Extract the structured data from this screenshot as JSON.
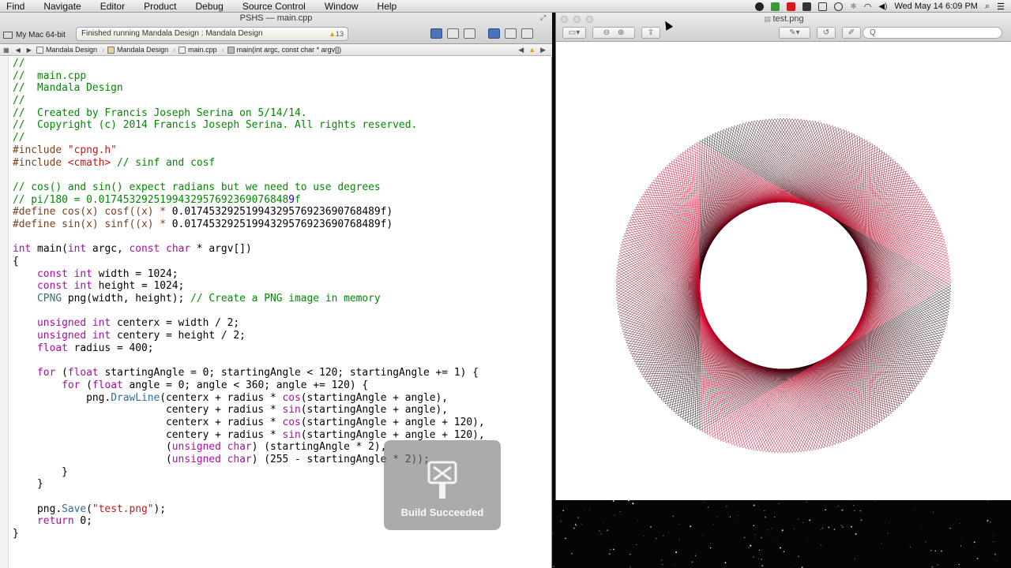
{
  "menubar": {
    "items": [
      "Find",
      "Navigate",
      "Editor",
      "Product",
      "Debug",
      "Source Control",
      "Window",
      "Help"
    ],
    "clock": "Wed May 14  6:09 PM"
  },
  "xcode": {
    "window_title": "PSHS — ",
    "file_title": "main.cpp",
    "scheme": "My Mac 64-bit",
    "activity": "Finished running Mandala Design : Mandala Design",
    "warning_count": "13",
    "breadcrumbs": [
      "Mandala Design",
      "Mandala Design",
      "main.cpp",
      "main(int argc, const char * argv[])"
    ],
    "hud_label": "Build Succeeded"
  },
  "code_lines": [
    [
      [
        "c-com",
        "//"
      ]
    ],
    [
      [
        "c-com",
        "//  main.cpp"
      ]
    ],
    [
      [
        "c-com",
        "//  Mandala Design"
      ]
    ],
    [
      [
        "c-com",
        "//"
      ]
    ],
    [
      [
        "c-com",
        "//  Created by Francis Joseph Serina on 5/14/14."
      ]
    ],
    [
      [
        "c-com",
        "//  Copyright (c) 2014 Francis Joseph Serina. All rights reserved."
      ]
    ],
    [
      [
        "c-com",
        "//"
      ]
    ],
    [
      [
        "c-pp",
        "#include "
      ],
      [
        "c-str",
        "\"cpng.h\""
      ]
    ],
    [
      [
        "c-pp",
        "#include "
      ],
      [
        "c-str",
        "<cmath>"
      ],
      [
        "c-com",
        " // sinf and cosf"
      ]
    ],
    [
      [
        "",
        ""
      ]
    ],
    [
      [
        "c-com",
        "// cos() and sin() expect radians but we need to use degrees"
      ]
    ],
    [
      [
        "c-com",
        "// pi/180 = 0.0174532925199432957692369076848"
      ],
      [
        "c-num",
        "9"
      ],
      [
        "c-com",
        "f"
      ]
    ],
    [
      [
        "c-pp",
        "#define cos(x) cosf((x) * "
      ],
      [
        "",
        "0.01745329251994329576923690768489f)"
      ]
    ],
    [
      [
        "c-pp",
        "#define sin(x) sinf((x) * "
      ],
      [
        "",
        "0.01745329251994329576923690768489f)"
      ]
    ],
    [
      [
        "",
        ""
      ]
    ],
    [
      [
        "c-kw",
        "int"
      ],
      [
        "",
        " main("
      ],
      [
        "c-kw",
        "int"
      ],
      [
        "",
        " argc, "
      ],
      [
        "c-kw",
        "const"
      ],
      [
        "",
        " "
      ],
      [
        "c-kw",
        "char"
      ],
      [
        "",
        " * argv[])"
      ]
    ],
    [
      [
        "",
        "{"
      ]
    ],
    [
      [
        "",
        "    "
      ],
      [
        "c-kw",
        "const int"
      ],
      [
        "",
        " width = 1024;"
      ]
    ],
    [
      [
        "",
        "    "
      ],
      [
        "c-kw",
        "const int"
      ],
      [
        "",
        " height = 1024;"
      ]
    ],
    [
      [
        "",
        "    "
      ],
      [
        "c-cls",
        "CPNG"
      ],
      [
        "",
        " png(width, height); "
      ],
      [
        "c-com",
        "// Create a PNG image in memory"
      ]
    ],
    [
      [
        "",
        ""
      ]
    ],
    [
      [
        "",
        "    "
      ],
      [
        "c-kw",
        "unsigned int"
      ],
      [
        "",
        " centerx = width / 2;"
      ]
    ],
    [
      [
        "",
        "    "
      ],
      [
        "c-kw",
        "unsigned int"
      ],
      [
        "",
        " centery = height / 2;"
      ]
    ],
    [
      [
        "",
        "    "
      ],
      [
        "c-kw",
        "float"
      ],
      [
        "",
        " radius = 400;"
      ]
    ],
    [
      [
        "",
        ""
      ]
    ],
    [
      [
        "",
        "    "
      ],
      [
        "c-kw",
        "for"
      ],
      [
        "",
        " ("
      ],
      [
        "c-kw",
        "float"
      ],
      [
        "",
        " startingAngle = 0; startingAngle < 120; startingAngle += 1) {"
      ]
    ],
    [
      [
        "",
        "        "
      ],
      [
        "c-kw",
        "for"
      ],
      [
        "",
        " ("
      ],
      [
        "c-kw",
        "float"
      ],
      [
        "",
        " angle = 0; angle < 360; angle += 120) {"
      ]
    ],
    [
      [
        "",
        "            png."
      ],
      [
        "c-fn",
        "DrawLine"
      ],
      [
        "",
        "(centerx + radius * "
      ],
      [
        "c-kw",
        "cos"
      ],
      [
        "",
        "(startingAngle + angle),"
      ]
    ],
    [
      [
        "",
        "                         centery + radius * "
      ],
      [
        "c-kw",
        "sin"
      ],
      [
        "",
        "(startingAngle + angle),"
      ]
    ],
    [
      [
        "",
        "                         centerx + radius * "
      ],
      [
        "c-kw",
        "cos"
      ],
      [
        "",
        "(startingAngle + angle + 120),"
      ]
    ],
    [
      [
        "",
        "                         centery + radius * "
      ],
      [
        "c-kw",
        "sin"
      ],
      [
        "",
        "(startingAngle + angle + 120),"
      ]
    ],
    [
      [
        "",
        "                         ("
      ],
      [
        "c-kw",
        "unsigned char"
      ],
      [
        "",
        ") (startingAngle * 2),"
      ]
    ],
    [
      [
        "",
        "                         ("
      ],
      [
        "c-kw",
        "unsigned char"
      ],
      [
        "",
        ") (255 - startingAngle * 2));"
      ]
    ],
    [
      [
        "",
        "        }"
      ]
    ],
    [
      [
        "",
        "    }"
      ]
    ],
    [
      [
        "",
        ""
      ]
    ],
    [
      [
        "",
        "    png."
      ],
      [
        "c-fn",
        "Save"
      ],
      [
        "",
        "("
      ],
      [
        "c-str",
        "\"test.png\""
      ],
      [
        "",
        ");"
      ]
    ],
    [
      [
        "",
        "    "
      ],
      [
        "c-kw",
        "return"
      ],
      [
        "",
        " 0;"
      ]
    ],
    [
      [
        "",
        "}"
      ]
    ]
  ],
  "preview": {
    "title": "test.png",
    "search_placeholder": "Q"
  },
  "mandala": {
    "starting_angle_count": 120,
    "angle_step": 120,
    "colors": {
      "start": "#000000",
      "end": "#e8002a"
    }
  }
}
